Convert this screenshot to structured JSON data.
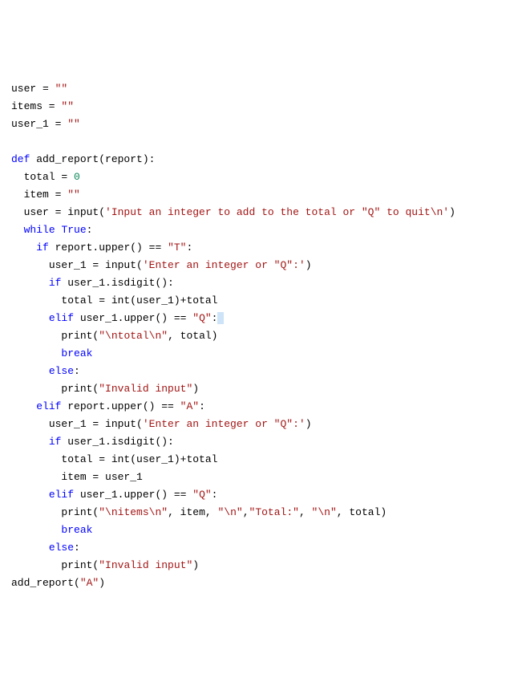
{
  "code": {
    "lines": [
      {
        "indent": 0,
        "tokens": [
          {
            "cls": "t-default",
            "text": "user = "
          },
          {
            "cls": "t-string",
            "text": "\"\""
          }
        ]
      },
      {
        "indent": 0,
        "tokens": [
          {
            "cls": "t-default",
            "text": "items = "
          },
          {
            "cls": "t-string",
            "text": "\"\""
          }
        ]
      },
      {
        "indent": 0,
        "tokens": [
          {
            "cls": "t-default",
            "text": "user_1 = "
          },
          {
            "cls": "t-string",
            "text": "\"\""
          }
        ]
      },
      {
        "indent": 0,
        "tokens": []
      },
      {
        "indent": 0,
        "tokens": [
          {
            "cls": "t-keyword",
            "text": "def"
          },
          {
            "cls": "t-default",
            "text": " add_report(report):"
          }
        ]
      },
      {
        "indent": 1,
        "tokens": [
          {
            "cls": "t-default",
            "text": "total = "
          },
          {
            "cls": "t-number",
            "text": "0"
          }
        ]
      },
      {
        "indent": 1,
        "tokens": [
          {
            "cls": "t-default",
            "text": "item = "
          },
          {
            "cls": "t-string",
            "text": "\"\""
          }
        ]
      },
      {
        "indent": 1,
        "tokens": [
          {
            "cls": "t-default",
            "text": "user = input("
          },
          {
            "cls": "t-string",
            "text": "'Input an integer to add to the total or \"Q\" to quit\\n'"
          },
          {
            "cls": "t-default",
            "text": ")"
          }
        ]
      },
      {
        "indent": 1,
        "tokens": [
          {
            "cls": "t-keyword",
            "text": "while"
          },
          {
            "cls": "t-default",
            "text": " "
          },
          {
            "cls": "t-keyword",
            "text": "True"
          },
          {
            "cls": "t-default",
            "text": ":"
          }
        ]
      },
      {
        "indent": 2,
        "tokens": [
          {
            "cls": "t-keyword",
            "text": "if"
          },
          {
            "cls": "t-default",
            "text": " report.upper() == "
          },
          {
            "cls": "t-string",
            "text": "\"T\""
          },
          {
            "cls": "t-default",
            "text": ":"
          }
        ]
      },
      {
        "indent": 3,
        "tokens": [
          {
            "cls": "t-default",
            "text": "user_1 = input("
          },
          {
            "cls": "t-string",
            "text": "'Enter an integer or \"Q\":'"
          },
          {
            "cls": "t-default",
            "text": ")"
          }
        ]
      },
      {
        "indent": 3,
        "tokens": [
          {
            "cls": "t-keyword",
            "text": "if"
          },
          {
            "cls": "t-default",
            "text": " user_1.isdigit():"
          }
        ]
      },
      {
        "indent": 4,
        "tokens": [
          {
            "cls": "t-default",
            "text": "total = int(user_1)+total"
          }
        ]
      },
      {
        "indent": 3,
        "tokens": [
          {
            "cls": "t-keyword",
            "text": "elif"
          },
          {
            "cls": "t-default",
            "text": " user_1.upper() == "
          },
          {
            "cls": "t-string",
            "text": "\"Q\""
          },
          {
            "cls": "t-default",
            "text": ":"
          },
          {
            "cls": "t-highlight",
            "text": " "
          }
        ]
      },
      {
        "indent": 4,
        "tokens": [
          {
            "cls": "t-default",
            "text": "print("
          },
          {
            "cls": "t-string",
            "text": "\"\\ntotal\\n\""
          },
          {
            "cls": "t-default",
            "text": ", total)"
          }
        ]
      },
      {
        "indent": 4,
        "tokens": [
          {
            "cls": "t-keyword",
            "text": "break"
          }
        ]
      },
      {
        "indent": 3,
        "tokens": [
          {
            "cls": "t-keyword",
            "text": "else"
          },
          {
            "cls": "t-default",
            "text": ":"
          }
        ]
      },
      {
        "indent": 4,
        "tokens": [
          {
            "cls": "t-default",
            "text": "print("
          },
          {
            "cls": "t-string",
            "text": "\"Invalid input\""
          },
          {
            "cls": "t-default",
            "text": ")"
          }
        ]
      },
      {
        "indent": 2,
        "tokens": [
          {
            "cls": "t-keyword",
            "text": "elif"
          },
          {
            "cls": "t-default",
            "text": " report.upper() == "
          },
          {
            "cls": "t-string",
            "text": "\"A\""
          },
          {
            "cls": "t-default",
            "text": ":"
          }
        ]
      },
      {
        "indent": 3,
        "tokens": [
          {
            "cls": "t-default",
            "text": "user_1 = input("
          },
          {
            "cls": "t-string",
            "text": "'Enter an integer or \"Q\":'"
          },
          {
            "cls": "t-default",
            "text": ")"
          }
        ]
      },
      {
        "indent": 3,
        "tokens": [
          {
            "cls": "t-keyword",
            "text": "if"
          },
          {
            "cls": "t-default",
            "text": " user_1.isdigit():"
          }
        ]
      },
      {
        "indent": 4,
        "tokens": [
          {
            "cls": "t-default",
            "text": "total = int(user_1)+total"
          }
        ]
      },
      {
        "indent": 4,
        "tokens": [
          {
            "cls": "t-default",
            "text": "item = user_1"
          }
        ]
      },
      {
        "indent": 3,
        "tokens": [
          {
            "cls": "t-keyword",
            "text": "elif"
          },
          {
            "cls": "t-default",
            "text": " user_1.upper() == "
          },
          {
            "cls": "t-string",
            "text": "\"Q\""
          },
          {
            "cls": "t-default",
            "text": ":"
          }
        ]
      },
      {
        "indent": 4,
        "tokens": [
          {
            "cls": "t-default",
            "text": "print("
          },
          {
            "cls": "t-string",
            "text": "\"\\nitems\\n\""
          },
          {
            "cls": "t-default",
            "text": ", item, "
          },
          {
            "cls": "t-string",
            "text": "\"\\n\""
          },
          {
            "cls": "t-default",
            "text": ","
          },
          {
            "cls": "t-string",
            "text": "\"Total:\""
          },
          {
            "cls": "t-default",
            "text": ", "
          },
          {
            "cls": "t-string",
            "text": "\"\\n\""
          },
          {
            "cls": "t-default",
            "text": ", total)"
          }
        ]
      },
      {
        "indent": 4,
        "tokens": [
          {
            "cls": "t-keyword",
            "text": "break"
          }
        ]
      },
      {
        "indent": 3,
        "tokens": [
          {
            "cls": "t-keyword",
            "text": "else"
          },
          {
            "cls": "t-default",
            "text": ":"
          }
        ]
      },
      {
        "indent": 4,
        "tokens": [
          {
            "cls": "t-default",
            "text": "print("
          },
          {
            "cls": "t-string",
            "text": "\"Invalid input\""
          },
          {
            "cls": "t-default",
            "text": ")"
          }
        ]
      },
      {
        "indent": 0,
        "tokens": [
          {
            "cls": "t-default",
            "text": "add_report("
          },
          {
            "cls": "t-string",
            "text": "\"A\""
          },
          {
            "cls": "t-default",
            "text": ")"
          }
        ]
      }
    ]
  }
}
